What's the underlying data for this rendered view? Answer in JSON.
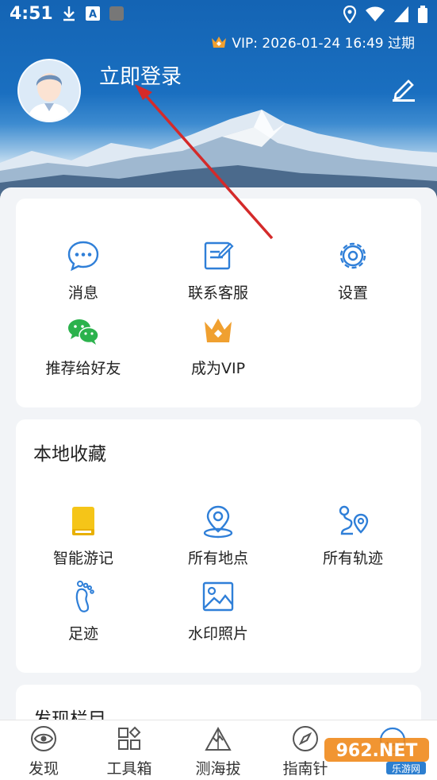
{
  "status_bar": {
    "time": "4:51",
    "icons_left": [
      "download-icon",
      "font-a-icon",
      "app-square-icon"
    ],
    "icons_right": [
      "location-icon",
      "wifi-icon",
      "signal-icon",
      "battery-icon"
    ]
  },
  "header": {
    "vip_text": "VIP: 2026-01-24 16:49 过期",
    "login_label": "立即登录",
    "edit_icon": "pencil-icon"
  },
  "menu_card": {
    "items": [
      {
        "label": "消息",
        "icon": "chat-bubble-icon"
      },
      {
        "label": "联系客服",
        "icon": "edit-note-icon"
      },
      {
        "label": "设置",
        "icon": "gear-icon"
      },
      {
        "label": "推荐给好友",
        "icon": "wechat-icon"
      },
      {
        "label": "成为VIP",
        "icon": "crown-icon"
      }
    ]
  },
  "local_card": {
    "title": "本地收藏",
    "items": [
      {
        "label": "智能游记",
        "icon": "notebook-icon"
      },
      {
        "label": "所有地点",
        "icon": "map-pin-icon"
      },
      {
        "label": "所有轨迹",
        "icon": "route-icon"
      },
      {
        "label": "足迹",
        "icon": "footprint-icon"
      },
      {
        "label": "水印照片",
        "icon": "image-icon"
      }
    ]
  },
  "discover_card": {
    "title": "发现栏目"
  },
  "tab_bar": {
    "tabs": [
      {
        "label": "发现",
        "icon": "eye-icon"
      },
      {
        "label": "工具箱",
        "icon": "toolbox-icon"
      },
      {
        "label": "测海拔",
        "icon": "mountain-icon"
      },
      {
        "label": "指南针",
        "icon": "compass-icon"
      }
    ]
  },
  "watermark": {
    "brand": "962.NET",
    "sub": "乐游网"
  },
  "colors": {
    "accent_blue": "#2f7fd8",
    "vip_orange": "#f0a030",
    "wechat_green": "#2bb24c",
    "notebook_yellow": "#f5c518"
  }
}
